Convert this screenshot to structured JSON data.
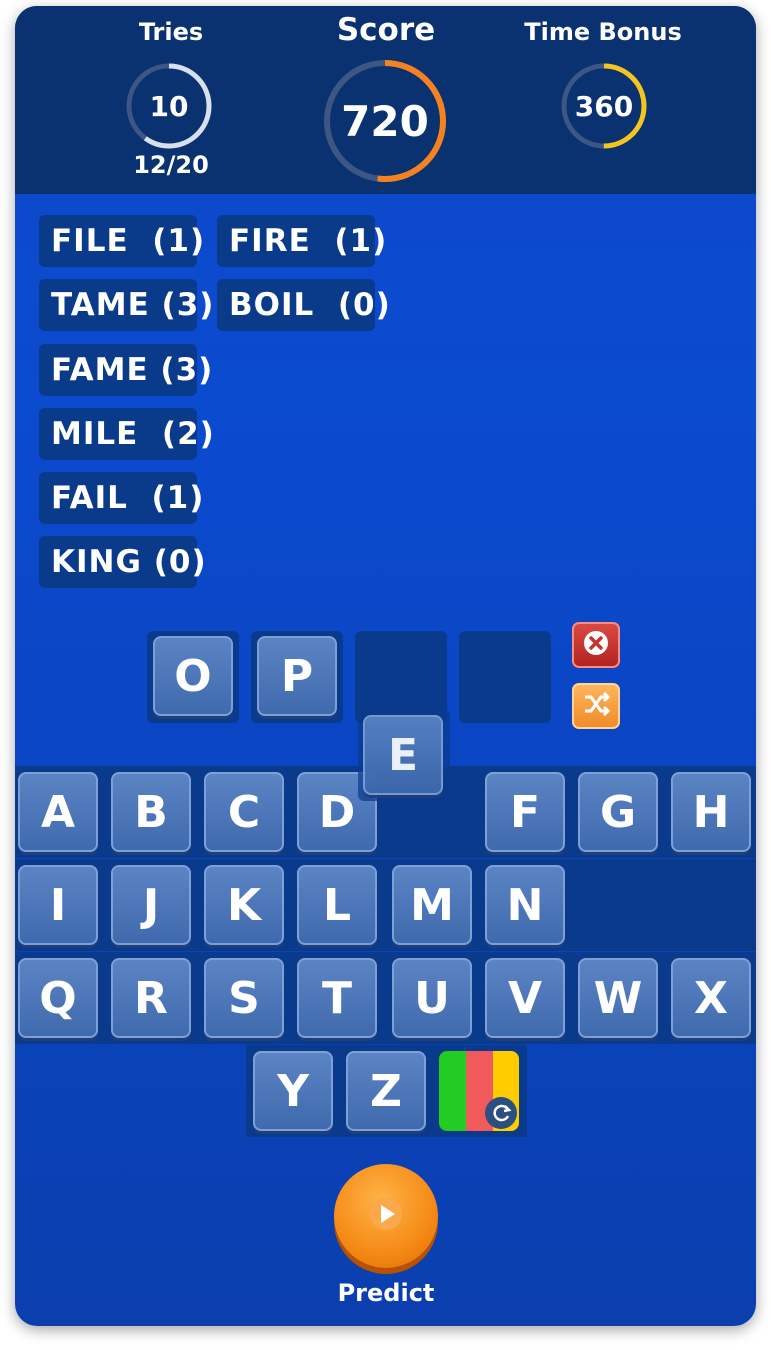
{
  "header": {
    "tries": {
      "label": "Tries",
      "value": "10",
      "progress_text": "12/20",
      "progress": 0.6
    },
    "score": {
      "label": "Score",
      "value": "720",
      "progress": 0.52
    },
    "time_bonus": {
      "label": "Time Bonus",
      "value": "360",
      "progress": 0.5
    }
  },
  "guesses": [
    {
      "word": "FILE",
      "count": "(1)",
      "text": "FILE  (1)"
    },
    {
      "word": "TAME",
      "count": "(3)",
      "text": "TAME (3)"
    },
    {
      "word": "FAME",
      "count": "(3)",
      "text": "FAME (3)"
    },
    {
      "word": "MILE",
      "count": "(2)",
      "text": "MILE  (2)"
    },
    {
      "word": "FAIL",
      "count": "(1)",
      "text": "FAIL  (1)"
    },
    {
      "word": "KING",
      "count": "(0)",
      "text": "KING (0)"
    },
    {
      "word": "FIRE",
      "count": "(1)",
      "text": "FIRE  (1)"
    },
    {
      "word": "BOIL",
      "count": "(0)",
      "text": "BOIL  (0)"
    }
  ],
  "input_slots": [
    "O",
    "P",
    "",
    ""
  ],
  "dragging_tile": "E",
  "keyboard": {
    "row1": [
      "A",
      "B",
      "C",
      "D",
      "F",
      "G",
      "H"
    ],
    "row2": [
      "I",
      "J",
      "K",
      "L",
      "M",
      "N"
    ],
    "row3": [
      "Q",
      "R",
      "S",
      "T",
      "U",
      "V",
      "W",
      "X"
    ],
    "row4": [
      "Y",
      "Z"
    ]
  },
  "buttons": {
    "clear_icon": "x-icon",
    "shuffle_icon": "shuffle-icon",
    "color_toggle_icon": "refresh-icon",
    "predict_label": "Predict"
  },
  "colors": {
    "score_ring": "#f5821f",
    "time_ring": "#f5c51f",
    "tries_ring": "#d8e0ee",
    "clear_button": "#c7312e",
    "shuffle_button": "#f5a040",
    "color_strip": [
      "#22cc22",
      "#f05a5a",
      "#ffcc00"
    ]
  }
}
